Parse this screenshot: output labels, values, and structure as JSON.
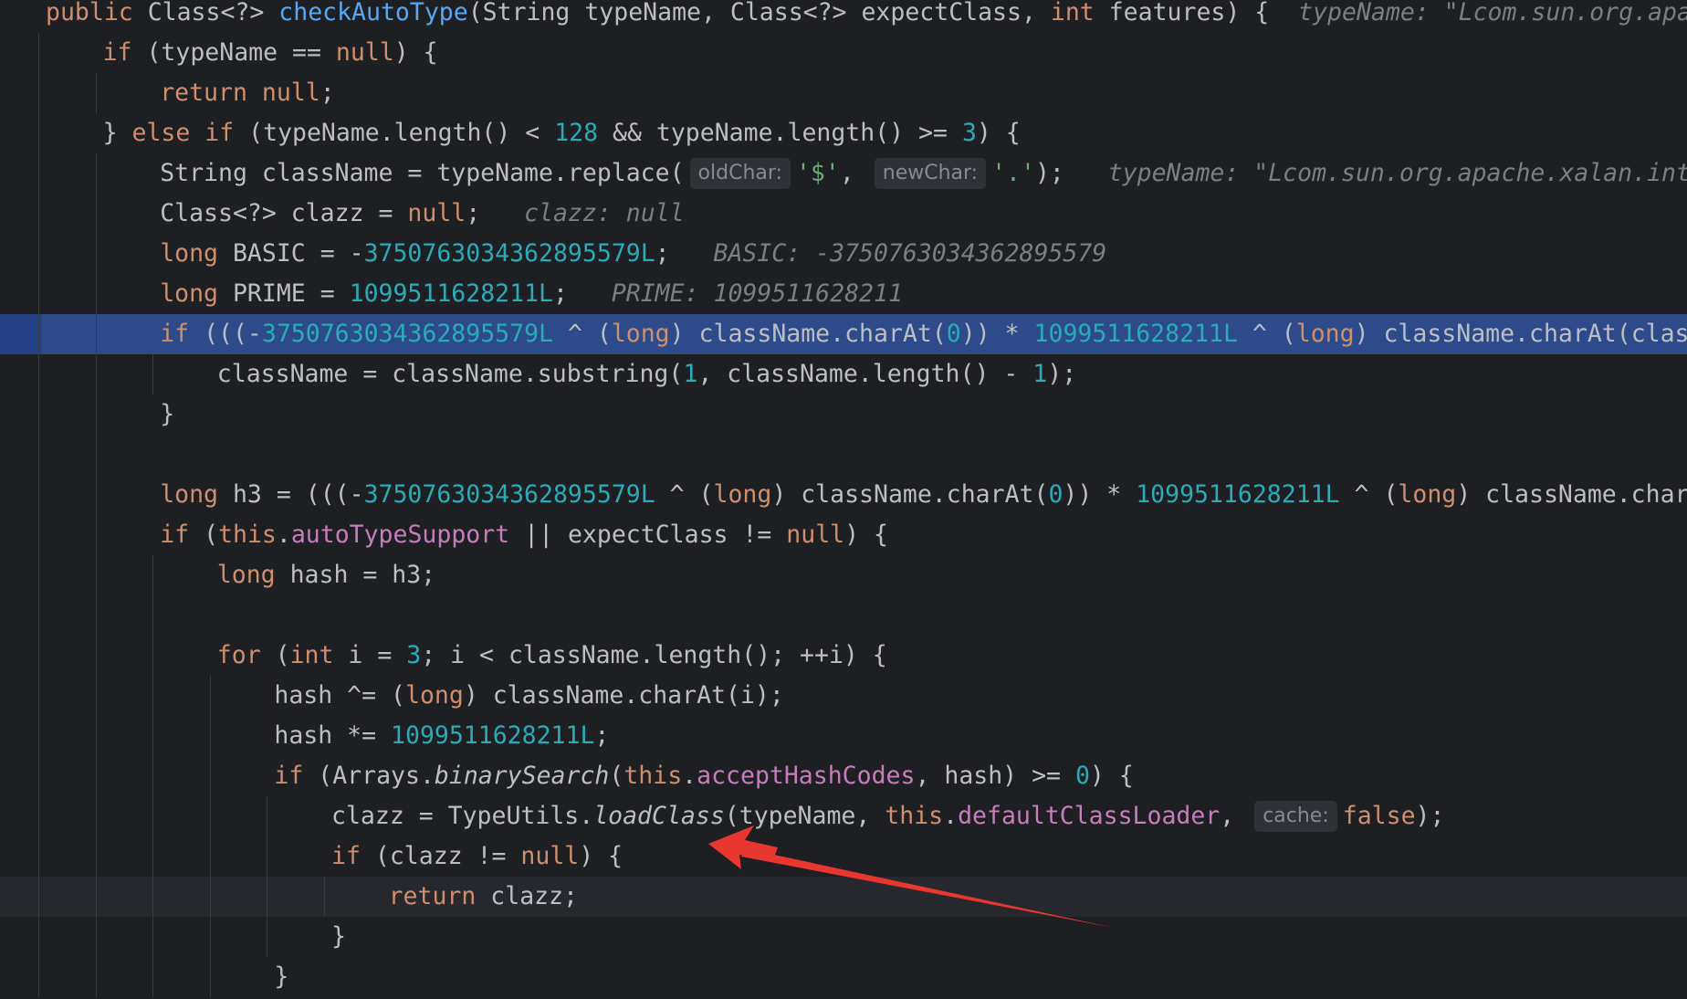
{
  "editor": {
    "lines": [
      {
        "indent": 1,
        "segs": [
          [
            "kw",
            "public "
          ],
          [
            "",
            "Class<?> "
          ],
          [
            "fn",
            "checkAutoType"
          ],
          [
            "",
            "(String typeName, Class<?> expectClass, "
          ],
          [
            "kw",
            "int "
          ],
          [
            "",
            "features) {  "
          ],
          [
            "hint",
            "typeName: \"Lcom.sun.org.apach"
          ]
        ]
      },
      {
        "indent": 2,
        "segs": [
          [
            "kw",
            "if "
          ],
          [
            "",
            "(typeName == "
          ],
          [
            "kw",
            "null"
          ],
          [
            "",
            ") {"
          ]
        ]
      },
      {
        "indent": 3,
        "segs": [
          [
            "kw",
            "return null"
          ],
          [
            "",
            ";"
          ]
        ]
      },
      {
        "indent": 2,
        "segs": [
          [
            "",
            "} "
          ],
          [
            "kw",
            "else if "
          ],
          [
            "",
            "(typeName.length() < "
          ],
          [
            "num",
            "128"
          ],
          [
            "",
            " && typeName.length() >= "
          ],
          [
            "num",
            "3"
          ],
          [
            "",
            ") {"
          ]
        ]
      },
      {
        "indent": 3,
        "segs": [
          [
            "",
            "String className = typeName.replace("
          ],
          [
            "chip",
            "oldChar:"
          ],
          [
            "str",
            "'$'"
          ],
          [
            "",
            ", "
          ],
          [
            "chip",
            "newChar:"
          ],
          [
            "str",
            "'.'"
          ],
          [
            "",
            ");   "
          ],
          [
            "hint",
            "typeName: \"Lcom.sun.org.apache.xalan.inter"
          ]
        ]
      },
      {
        "indent": 3,
        "segs": [
          [
            "",
            "Class<?> clazz = "
          ],
          [
            "kw",
            "null"
          ],
          [
            "",
            ";   "
          ],
          [
            "hint",
            "clazz: null"
          ]
        ]
      },
      {
        "indent": 3,
        "segs": [
          [
            "kw",
            "long "
          ],
          [
            "",
            "BASIC = -"
          ],
          [
            "num",
            "3750763034362895579L"
          ],
          [
            "",
            ";   "
          ],
          [
            "hint",
            "BASIC: -3750763034362895579"
          ]
        ]
      },
      {
        "indent": 3,
        "segs": [
          [
            "kw",
            "long "
          ],
          [
            "",
            "PRIME = "
          ],
          [
            "num",
            "1099511628211L"
          ],
          [
            "",
            ";   "
          ],
          [
            "hint",
            "PRIME: 1099511628211"
          ]
        ]
      },
      {
        "indent": 3,
        "exec": true,
        "segs": [
          [
            "kw",
            "if "
          ],
          [
            "",
            "(((-"
          ],
          [
            "num",
            "3750763034362895579L"
          ],
          [
            "",
            " ^ ("
          ],
          [
            "kw",
            "long"
          ],
          [
            "",
            ") className.charAt("
          ],
          [
            "num",
            "0"
          ],
          [
            "",
            ")) * "
          ],
          [
            "num",
            "1099511628211L"
          ],
          [
            "",
            " ^ ("
          ],
          [
            "kw",
            "long"
          ],
          [
            "",
            ") className.charAt(classN"
          ]
        ]
      },
      {
        "indent": 4,
        "segs": [
          [
            "",
            "className = className.substring("
          ],
          [
            "num",
            "1"
          ],
          [
            "",
            ", className.length() - "
          ],
          [
            "num",
            "1"
          ],
          [
            "",
            ");"
          ]
        ]
      },
      {
        "indent": 3,
        "segs": [
          [
            "",
            "}"
          ]
        ]
      },
      {
        "indent": 0,
        "segs": []
      },
      {
        "indent": 3,
        "segs": [
          [
            "kw",
            "long "
          ],
          [
            "",
            "h3 = (((-"
          ],
          [
            "num",
            "3750763034362895579L"
          ],
          [
            "",
            " ^ ("
          ],
          [
            "kw",
            "long"
          ],
          [
            "",
            ") className.charAt("
          ],
          [
            "num",
            "0"
          ],
          [
            "",
            ")) * "
          ],
          [
            "num",
            "1099511628211L"
          ],
          [
            "",
            " ^ ("
          ],
          [
            "kw",
            "long"
          ],
          [
            "",
            ") className.charAt"
          ]
        ]
      },
      {
        "indent": 3,
        "segs": [
          [
            "kw",
            "if "
          ],
          [
            "",
            "("
          ],
          [
            "kw",
            "this"
          ],
          [
            "",
            "."
          ],
          [
            "fld",
            "autoTypeSupport"
          ],
          [
            "",
            " || expectClass != "
          ],
          [
            "kw",
            "null"
          ],
          [
            "",
            ") {"
          ]
        ]
      },
      {
        "indent": 4,
        "segs": [
          [
            "kw",
            "long "
          ],
          [
            "",
            "hash = h3;"
          ]
        ]
      },
      {
        "indent": 0,
        "segs": []
      },
      {
        "indent": 4,
        "segs": [
          [
            "kw",
            "for "
          ],
          [
            "",
            "("
          ],
          [
            "kw",
            "int "
          ],
          [
            "",
            "i = "
          ],
          [
            "num",
            "3"
          ],
          [
            "",
            "; i < className.length(); ++i) {"
          ]
        ]
      },
      {
        "indent": 5,
        "segs": [
          [
            "",
            "hash ^= ("
          ],
          [
            "kw",
            "long"
          ],
          [
            "",
            ") className.charAt(i);"
          ]
        ]
      },
      {
        "indent": 5,
        "segs": [
          [
            "",
            "hash *= "
          ],
          [
            "num",
            "1099511628211L"
          ],
          [
            "",
            ";"
          ]
        ]
      },
      {
        "indent": 5,
        "segs": [
          [
            "kw",
            "if "
          ],
          [
            "",
            "(Arrays."
          ],
          [
            "it",
            "binarySearch"
          ],
          [
            "",
            "("
          ],
          [
            "kw",
            "this"
          ],
          [
            "",
            "."
          ],
          [
            "fld",
            "acceptHashCodes"
          ],
          [
            "",
            ", hash) >= "
          ],
          [
            "num",
            "0"
          ],
          [
            "",
            ") {"
          ]
        ]
      },
      {
        "indent": 6,
        "segs": [
          [
            "",
            "clazz = TypeUtils."
          ],
          [
            "it",
            "loadClass"
          ],
          [
            "",
            "(typeName, "
          ],
          [
            "kw",
            "this"
          ],
          [
            "",
            "."
          ],
          [
            "fld",
            "defaultClassLoader"
          ],
          [
            "",
            ", "
          ],
          [
            "chip",
            "cache:"
          ],
          [
            "kw",
            "false"
          ],
          [
            "",
            ");"
          ]
        ]
      },
      {
        "indent": 6,
        "segs": [
          [
            "kw",
            "if "
          ],
          [
            "",
            "(clazz != "
          ],
          [
            "kw",
            "null"
          ],
          [
            "",
            ") {"
          ]
        ]
      },
      {
        "indent": 7,
        "current": true,
        "segs": [
          [
            "kw",
            "return "
          ],
          [
            "",
            "clazz;"
          ]
        ]
      },
      {
        "indent": 6,
        "segs": [
          [
            "",
            "}"
          ]
        ]
      },
      {
        "indent": 5,
        "segs": [
          [
            "",
            "}"
          ]
        ]
      }
    ]
  },
  "colors": {
    "background": "#1e1f22",
    "keyword": "#cf8e6d",
    "method": "#56a8f5",
    "number": "#2aacb8",
    "string": "#6aab73",
    "field": "#c77dbb",
    "hint": "#7a7e85",
    "exec_line": "#2d4a8a",
    "annotation_arrow": "#e8372e"
  }
}
